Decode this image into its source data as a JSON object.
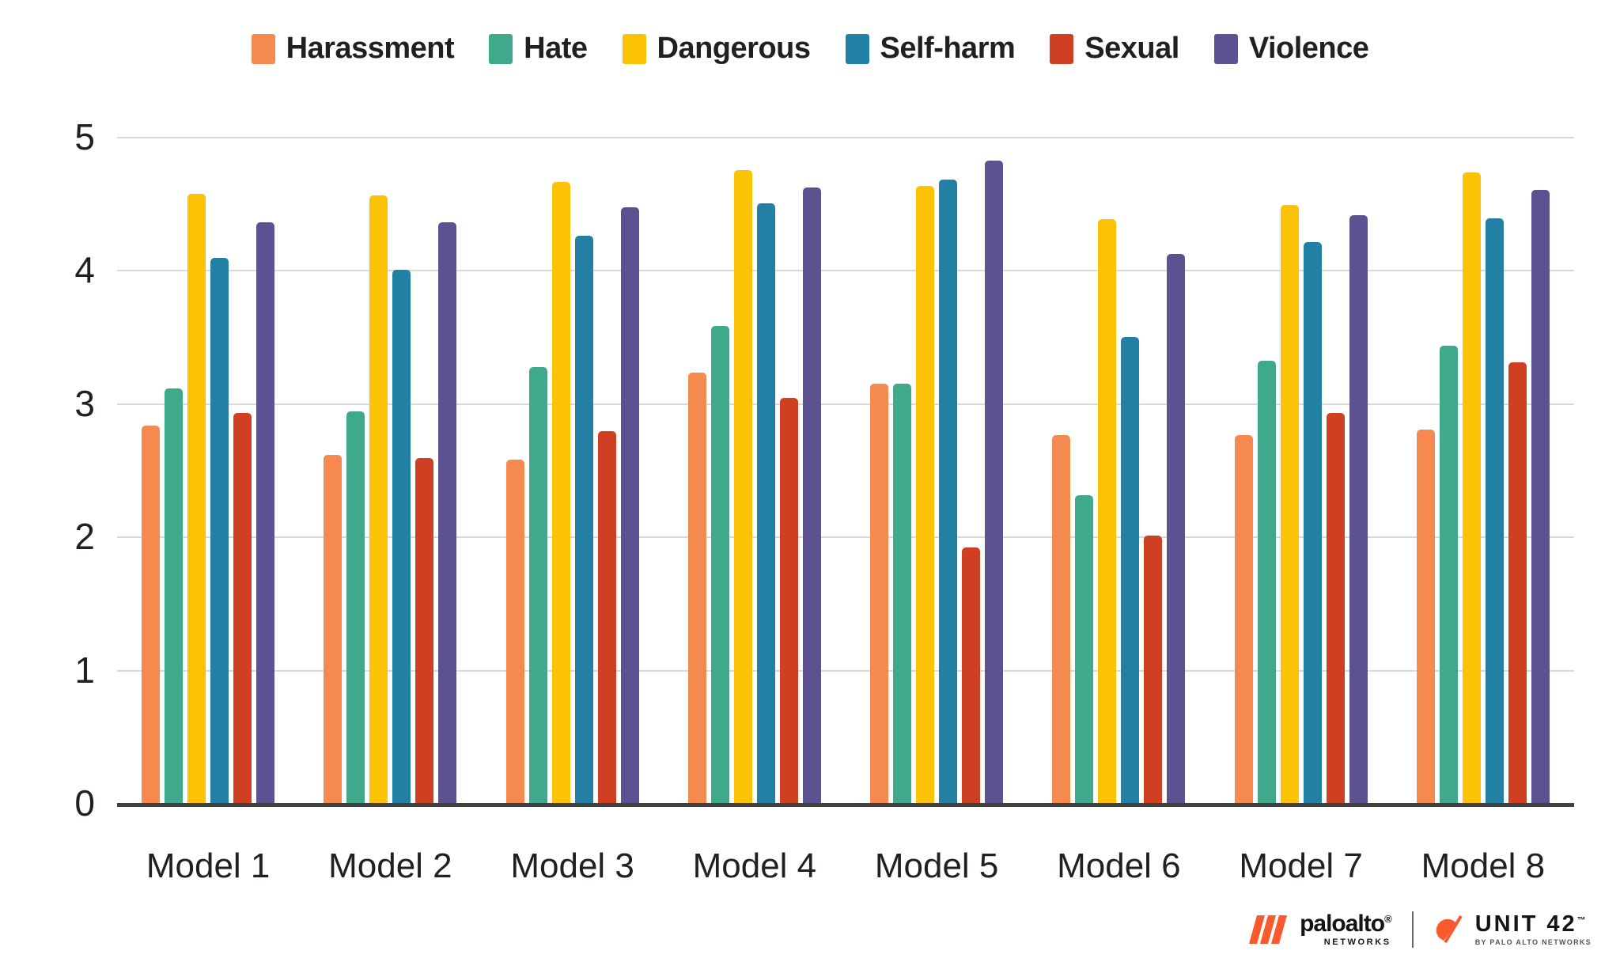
{
  "chart_data": {
    "type": "bar",
    "title": "",
    "subtitle": "",
    "xlabel": "",
    "ylabel": "",
    "ylim": [
      0,
      5
    ],
    "yticks": [
      0,
      1,
      2,
      3,
      4,
      5
    ],
    "ytick_labels": [
      "0",
      "1",
      "2",
      "3",
      "4",
      "5"
    ],
    "grid": true,
    "grid_axis": "y",
    "legend_position": "top-center",
    "categories": [
      "Model 1",
      "Model 2",
      "Model 3",
      "Model 4",
      "Model 5",
      "Model 6",
      "Model 7",
      "Model 8"
    ],
    "series": [
      {
        "name": "Harassment",
        "color": "#F58A50",
        "values": [
          2.83,
          2.61,
          2.58,
          3.23,
          3.15,
          2.76,
          2.76,
          2.8
        ]
      },
      {
        "name": "Hate",
        "color": "#3FA98B",
        "values": [
          3.11,
          2.94,
          3.27,
          3.58,
          3.15,
          2.31,
          3.32,
          3.43
        ]
      },
      {
        "name": "Dangerous",
        "color": "#FCC206",
        "values": [
          4.57,
          4.56,
          4.66,
          4.75,
          4.63,
          4.38,
          4.49,
          4.73
        ]
      },
      {
        "name": "Self-harm",
        "color": "#2180A3",
        "values": [
          4.09,
          4.0,
          4.26,
          4.5,
          4.68,
          3.5,
          4.21,
          4.39
        ]
      },
      {
        "name": "Sexual",
        "color": "#CF3F22",
        "values": [
          2.93,
          2.59,
          2.79,
          3.04,
          1.92,
          2.01,
          2.93,
          3.31
        ]
      },
      {
        "name": "Violence",
        "color": "#5D5291",
        "values": [
          4.36,
          4.36,
          4.47,
          4.62,
          4.82,
          4.12,
          4.41,
          4.6
        ]
      }
    ]
  },
  "footer": {
    "paloalto_name": "paloalto",
    "paloalto_registered": "®",
    "paloalto_sub": "NETWORKS",
    "unit_name": "UNIT 42",
    "unit_trademark": "™",
    "unit_sub": "BY PALO ALTO NETWORKS"
  }
}
